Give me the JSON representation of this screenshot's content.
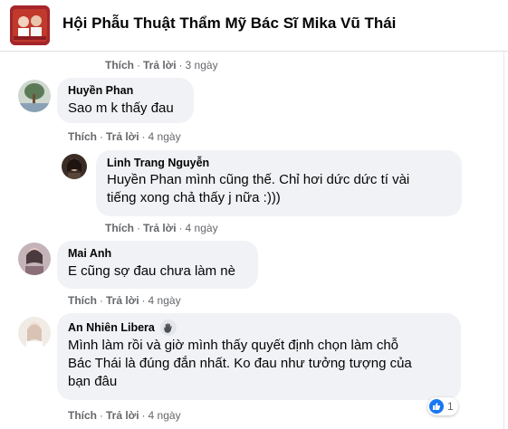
{
  "header": {
    "title": "Hội Phẫu Thuật Thẩm Mỹ Bác Sĩ Mika Vũ Thái"
  },
  "colors": {
    "bubble": "#f0f2f5",
    "meta": "#65676b",
    "like_blue": "#1877f2",
    "wave_badge": "#e4e6eb"
  },
  "top_actions": {
    "like": "Thích",
    "reply": "Trả lời",
    "time": "3 ngày"
  },
  "comments": [
    {
      "author": "Huyền Phan",
      "text": "Sao m k thấy đau",
      "actions": {
        "like": "Thích",
        "reply": "Trả lời",
        "time": "4 ngày"
      }
    },
    {
      "author": "Linh Trang Nguyễn",
      "mention": "Huyền Phan",
      "text_line1": "mình cũng thế. Chỉ hơi dức dức tí vài",
      "text_line2": "tiếng xong chả thấy j nữa :)))",
      "actions": {
        "like": "Thích",
        "reply": "Trả lời",
        "time": "4 ngày"
      }
    },
    {
      "author": "Mai Anh",
      "text": "E cũng sợ đau chưa làm nè",
      "actions": {
        "like": "Thích",
        "reply": "Trả lời",
        "time": "4 ngày"
      }
    },
    {
      "author": "An Nhiên Libera",
      "badge_icon": "wave-hand-icon",
      "text_line1": "Mình làm rồi và giờ mình thấy quyết định chọn làm chỗ",
      "text_line2": "Bác Thái là đúng đắn nhất. Ko đau như tưởng tượng của",
      "text_line3": "bạn đâu",
      "reaction": {
        "icon": "like-icon",
        "count": "1"
      },
      "actions": {
        "like": "Thích",
        "reply": "Trả lời",
        "time": "4 ngày"
      }
    }
  ]
}
